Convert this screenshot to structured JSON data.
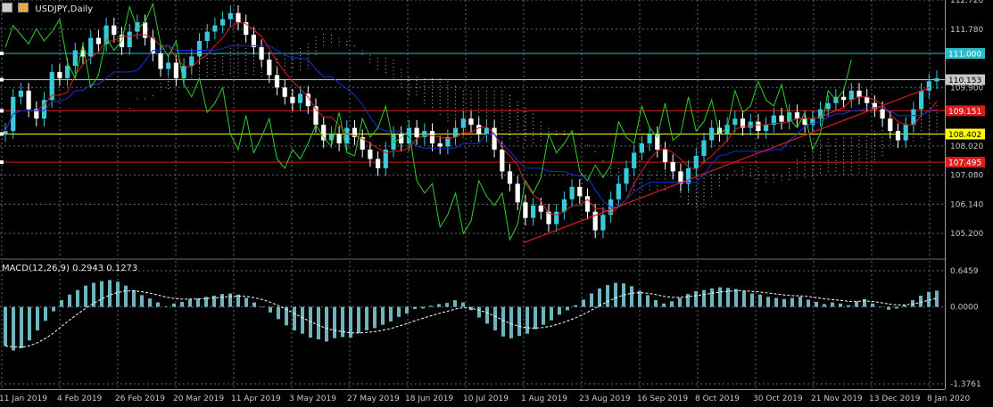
{
  "window": {
    "title": "USDJPY,Daily",
    "icons": [
      "window-icon",
      "chart-icon"
    ]
  },
  "colors": {
    "background": "#000000",
    "grid": "#5c6c78",
    "text": "#c8c8c8",
    "bull_candle": "#39c9d8",
    "bear_candle": "#ffffff",
    "tenkan": "#d81e1e",
    "kijun": "#1a2fd8",
    "chikou": "#2fcd2f",
    "cloud_dots": "#dddddd",
    "macd_hist": "#6fb4bd",
    "macd_signal": "#ffffff",
    "trendline": "#d81e1e",
    "level_cyan": "#30b9c8",
    "level_red": "#d81e1e",
    "level_yellow": "#ffff00",
    "level_white": "#ffffff"
  },
  "chart_data": [
    {
      "type": "candlestick",
      "title": "USDJPY,Daily",
      "ylim": [
        104.4,
        112.72
      ],
      "yticks": [
        "112.720",
        "111.780",
        "110.153",
        "109.900",
        "108.020",
        "107.080",
        "106.140",
        "105.200"
      ],
      "xticks": [
        "11 Jan 2019",
        "4 Feb 2019",
        "26 Feb 2019",
        "20 Mar 2019",
        "11 Apr 2019",
        "3 May 2019",
        "27 May 2019",
        "18 Jun 2019",
        "10 Jul 2019",
        "1 Aug 2019",
        "23 Aug 2019",
        "16 Sep 2019",
        "8 Oct 2019",
        "30 Oct 2019",
        "21 Nov 2019",
        "13 Dec 2019",
        "8 Jan 2020"
      ],
      "grid": true,
      "levels": [
        {
          "label": "111.000",
          "value": 111.0,
          "color": "#30b9c8"
        },
        {
          "label": "110.153",
          "value": 110.153,
          "color": "#c8c8c8"
        },
        {
          "label": "109.151",
          "value": 109.151,
          "color": "#d81e1e"
        },
        {
          "label": "108.402",
          "value": 108.402,
          "color": "#ffff00"
        },
        {
          "label": "107.495",
          "value": 107.495,
          "color": "#d81e1e"
        }
      ],
      "trendline": {
        "from": [
          "1 Aug 2019",
          104.9
        ],
        "to": [
          "8 Jan 2020",
          109.9
        ]
      },
      "closes": [
        108.5,
        109.6,
        109.8,
        109.2,
        108.9,
        109.5,
        110.4,
        110.2,
        110.6,
        111.1,
        110.9,
        111.5,
        111.3,
        111.9,
        111.6,
        111.2,
        111.7,
        112.0,
        111.5,
        111.0,
        110.5,
        110.7,
        110.2,
        110.6,
        110.9,
        111.4,
        111.7,
        111.9,
        112.1,
        112.3,
        112.0,
        111.6,
        111.2,
        110.8,
        110.3,
        109.9,
        109.6,
        109.4,
        109.7,
        109.3,
        108.7,
        108.2,
        108.4,
        108.1,
        108.6,
        108.3,
        107.9,
        107.6,
        107.3,
        107.9,
        108.4,
        108.1,
        108.6,
        108.3,
        108.5,
        108.1,
        108.0,
        108.3,
        108.6,
        108.9,
        108.7,
        108.4,
        108.6,
        107.9,
        107.2,
        106.8,
        106.2,
        105.7,
        106.1,
        105.9,
        105.5,
        105.9,
        106.3,
        106.7,
        106.4,
        105.9,
        105.3,
        105.8,
        106.3,
        106.8,
        107.3,
        107.8,
        108.1,
        108.4,
        107.9,
        107.5,
        107.2,
        106.8,
        107.3,
        107.7,
        108.2,
        108.6,
        108.4,
        108.7,
        108.9,
        108.6,
        108.8,
        108.5,
        108.7,
        109.0,
        108.8,
        109.1,
        108.9,
        108.7,
        108.9,
        109.2,
        109.4,
        109.6,
        109.5,
        109.8,
        109.6,
        109.4,
        109.2,
        108.9,
        108.5,
        108.2,
        108.7,
        109.2,
        109.8,
        110.1,
        110.2
      ],
      "series": [
        {
          "name": "MACD(12,26,9)"
        }
      ]
    },
    {
      "type": "bar",
      "title": "MACD(12,26,9) 0.2943 0.1273",
      "ylim": [
        -1.3761,
        0.6459
      ],
      "yticks": [
        "0.6459",
        "0.0000",
        "-1.3761"
      ],
      "main_value": 0.2943,
      "signal_value": 0.1273,
      "values": [
        -0.7,
        -0.78,
        -0.74,
        -0.6,
        -0.42,
        -0.25,
        -0.08,
        0.12,
        0.22,
        0.3,
        0.38,
        0.43,
        0.46,
        0.48,
        0.45,
        0.38,
        0.3,
        0.21,
        0.15,
        0.08,
        0.01,
        0.06,
        0.09,
        0.14,
        0.15,
        0.18,
        0.2,
        0.23,
        0.24,
        0.22,
        0.16,
        0.08,
        -0.01,
        -0.1,
        -0.22,
        -0.33,
        -0.42,
        -0.48,
        -0.55,
        -0.58,
        -0.62,
        -0.56,
        -0.54,
        -0.55,
        -0.47,
        -0.42,
        -0.38,
        -0.32,
        -0.26,
        -0.18,
        -0.12,
        -0.04,
        -0.03,
        0.02,
        0.05,
        0.07,
        0.12,
        0.08,
        -0.06,
        -0.19,
        -0.3,
        -0.42,
        -0.53,
        -0.56,
        -0.52,
        -0.48,
        -0.4,
        -0.32,
        -0.24,
        -0.14,
        -0.06,
        0.03,
        0.13,
        0.24,
        0.33,
        0.39,
        0.43,
        0.42,
        0.37,
        0.29,
        0.21,
        0.12,
        0.06,
        0.1,
        0.16,
        0.23,
        0.28,
        0.3,
        0.33,
        0.35,
        0.34,
        0.32,
        0.28,
        0.24,
        0.22,
        0.18,
        0.16,
        0.14,
        0.16,
        0.18,
        0.13,
        0.09,
        0.05,
        0.08,
        0.06,
        0.03,
        0.1,
        0.14,
        0.06,
        -0.01,
        -0.05,
        -0.03,
        0.03,
        0.12,
        0.2,
        0.27,
        0.29
      ]
    }
  ]
}
